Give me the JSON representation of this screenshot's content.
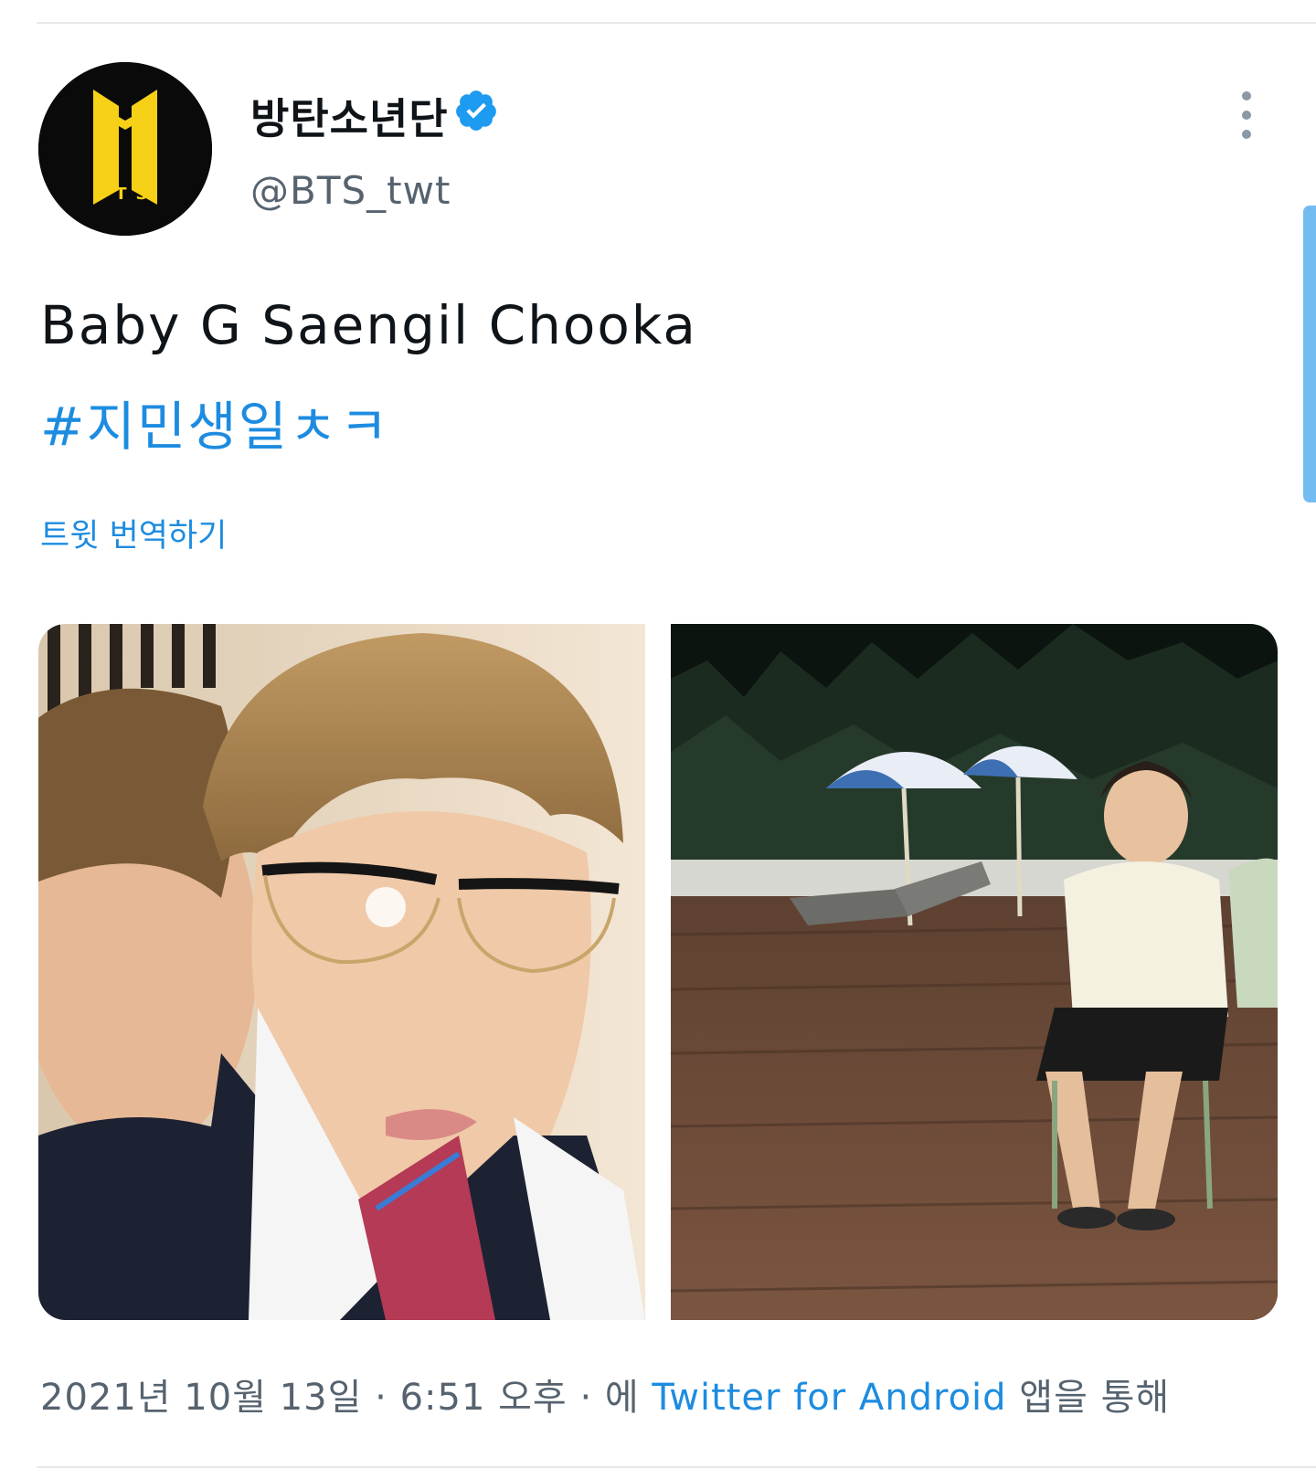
{
  "account": {
    "display_name": "방탄소년단",
    "handle": "@BTS_twt",
    "verified": true,
    "avatar_logo_text": "BTS"
  },
  "tweet": {
    "text": "Baby G Saengil Chooka",
    "hashtag": "#지민생일ㅊㅋ",
    "translate_label": "트윗 번역하기"
  },
  "meta": {
    "date": "2021년 10월 13일",
    "separator": "·",
    "time": "6:51 오후",
    "via_prefix": "에",
    "source": "Twitter for Android",
    "via_suffix": "앱을 통해"
  },
  "colors": {
    "link": "#1d8ce0",
    "verified_badge": "#1d9bf0",
    "secondary_text": "#56636f",
    "logo_yellow": "#f7d117"
  },
  "icons": {
    "verified": "verified-badge-icon",
    "more": "more-options-icon"
  }
}
